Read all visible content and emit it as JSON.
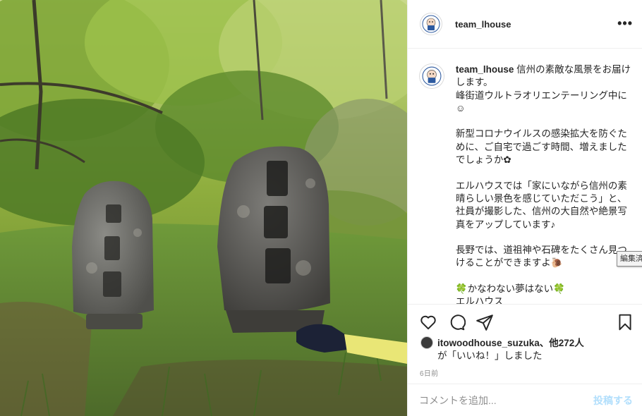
{
  "post": {
    "photo_alt": "",
    "colors": {
      "post_button": "#b2dffc",
      "text": "#262626",
      "muted": "#8e8e8e"
    }
  },
  "header": {
    "username": "team_lhouse",
    "more_icon": "more-horizontal-icon"
  },
  "caption": {
    "username": "team_lhouse",
    "text": " 信州の素敵な風景をお届けします。\n峰街道ウルトラオリエンテーリング中に☺\n\n新型コロナウイルスの感染拡大を防ぐために、ご自宅で過ごす時間、増えましたでしょうか✿\n\nエルハウスでは「家にいながら信州の素晴らしい景色を感じていただこう」と、社員が撮影した、信州の大自然や絶景写真をアップしています♪\n\n長野では、道祖神や石碑をたくさん見つけることができますよ🐌\n\n🍀かなわない夢はない🍀\nエルハウス"
  },
  "tooltip": {
    "text": "編集済"
  },
  "actions": {
    "like_icon": "heart-icon",
    "comment_icon": "comment-icon",
    "share_icon": "paper-plane-icon",
    "save_icon": "bookmark-icon"
  },
  "likes": {
    "user": "itowoodhouse_suzuka",
    "suffix": "、他272人",
    "line2": "が「いいね！」しました"
  },
  "timestamp": "6日前",
  "comment": {
    "placeholder": "コメントを追加...",
    "post_label": "投稿する"
  }
}
